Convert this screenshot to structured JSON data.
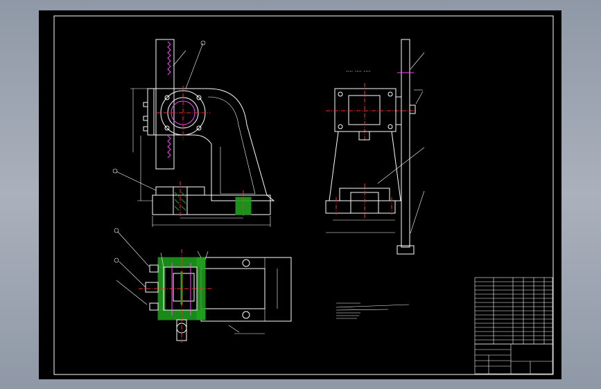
{
  "drawing": {
    "title": "",
    "colors": {
      "background": "#000000",
      "outline": "#ffffff",
      "centerline": "#ff2a2a",
      "hidden": "#ff44ff",
      "section": "#1fa11f"
    }
  },
  "icons": [
    "front-view-icon",
    "side-view-icon",
    "top-view-icon",
    "title-block-icon"
  ]
}
